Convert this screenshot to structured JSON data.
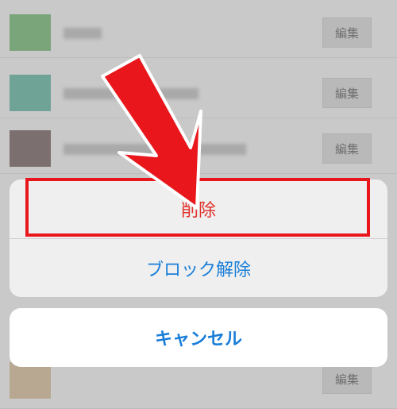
{
  "list": {
    "rows": [
      {
        "edit_label": "編集",
        "avatar_color": "#7aa57a"
      },
      {
        "edit_label": "編集",
        "avatar_color": "#6fa396"
      },
      {
        "edit_label": "編集",
        "avatar_color": "#7c6f70"
      },
      {
        "edit_label": "編集",
        "avatar_color": "#b8a892"
      }
    ]
  },
  "action_sheet": {
    "delete_label": "削除",
    "unblock_label": "ブロック解除",
    "cancel_label": "キャンセル"
  },
  "colors": {
    "destructive": "#e0312a",
    "accent": "#1a7ed8",
    "highlight": "#e9161b"
  }
}
